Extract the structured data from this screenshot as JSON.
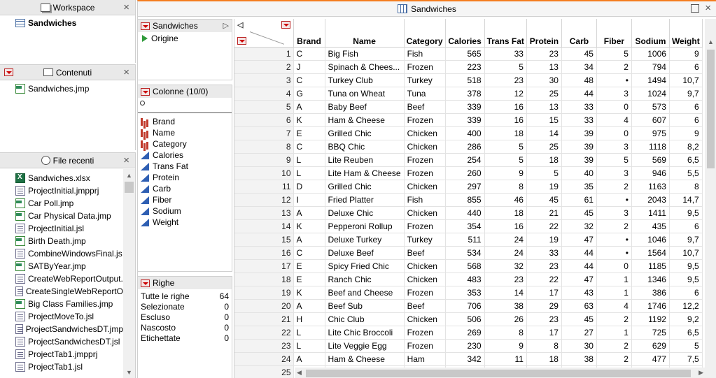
{
  "workspace": {
    "title": "Workspace",
    "item": "Sandwiches"
  },
  "contents": {
    "title": "Contenuti",
    "item": "Sandwiches.jmp"
  },
  "recent": {
    "title": "File recenti",
    "items": [
      {
        "label": "Sandwiches.xlsx",
        "icon": "xlsx-icon"
      },
      {
        "label": "ProjectInitial.jmpprj",
        "icon": "file-icon"
      },
      {
        "label": "Car Poll.jmp",
        "icon": "jmp-table-icon"
      },
      {
        "label": "Car Physical Data.jmp",
        "icon": "jmp-table-icon"
      },
      {
        "label": "ProjectInitial.jsl",
        "icon": "file-icon"
      },
      {
        "label": "Birth Death.jmp",
        "icon": "jmp-table-icon"
      },
      {
        "label": "CombineWindowsFinal.js",
        "icon": "file-icon"
      },
      {
        "label": "SATByYear.jmp",
        "icon": "jmp-table-icon"
      },
      {
        "label": "CreateWebReportOutput.",
        "icon": "file-icon"
      },
      {
        "label": "CreateSingleWebReportO",
        "icon": "file-icon"
      },
      {
        "label": "Big Class Families.jmp",
        "icon": "jmp-table-icon"
      },
      {
        "label": "ProjectMoveTo.jsl",
        "icon": "file-icon"
      },
      {
        "label": "ProjectSandwichesDT.jmp",
        "icon": "file-icon"
      },
      {
        "label": "ProjectSandwichesDT.jsl",
        "icon": "file-icon"
      },
      {
        "label": "ProjectTab1.jmpprj",
        "icon": "file-icon"
      },
      {
        "label": "ProjectTab1.jsl",
        "icon": "file-icon"
      }
    ]
  },
  "window": {
    "title": "Sandwiches"
  },
  "table_panel": {
    "name": "Sandwiches",
    "source": "Origine"
  },
  "columns_panel": {
    "title": "Colonne (10/0)",
    "columns": [
      {
        "label": "Brand",
        "icon": "nominal-column-icon"
      },
      {
        "label": "Name",
        "icon": "nominal-column-icon"
      },
      {
        "label": "Category",
        "icon": "nominal-column-icon"
      },
      {
        "label": "Calories",
        "icon": "continuous-column-icon"
      },
      {
        "label": "Trans Fat",
        "icon": "continuous-column-icon"
      },
      {
        "label": "Protein",
        "icon": "continuous-column-icon"
      },
      {
        "label": "Carb",
        "icon": "continuous-column-icon"
      },
      {
        "label": "Fiber",
        "icon": "continuous-column-icon"
      },
      {
        "label": "Sodium",
        "icon": "continuous-column-icon"
      },
      {
        "label": "Weight",
        "icon": "continuous-column-icon"
      }
    ]
  },
  "rows_panel": {
    "title": "Righe",
    "items": [
      {
        "label": "Tutte le righe",
        "value": "64"
      },
      {
        "label": "Selezionate",
        "value": "0"
      },
      {
        "label": "Escluso",
        "value": "0"
      },
      {
        "label": "Nascosto",
        "value": "0"
      },
      {
        "label": "Etichettate",
        "value": "0"
      }
    ]
  },
  "grid": {
    "headers": [
      "Brand",
      "Name",
      "Category",
      "Calories",
      "Trans Fat",
      "Protein",
      "Carb",
      "Fiber",
      "Sodium",
      "Weight"
    ],
    "rows": [
      [
        "1",
        "C",
        "Big Fish",
        "Fish",
        "565",
        "33",
        "23",
        "45",
        "5",
        "1006",
        "9"
      ],
      [
        "2",
        "J",
        "Spinach & Chees...",
        "Frozen",
        "223",
        "5",
        "13",
        "34",
        "2",
        "794",
        "6"
      ],
      [
        "3",
        "C",
        "Turkey Club",
        "Turkey",
        "518",
        "23",
        "30",
        "48",
        "•",
        "1494",
        "10,7"
      ],
      [
        "4",
        "G",
        "Tuna on Wheat",
        "Tuna",
        "378",
        "12",
        "25",
        "44",
        "3",
        "1024",
        "9,7"
      ],
      [
        "5",
        "A",
        "Baby Beef",
        "Beef",
        "339",
        "16",
        "13",
        "33",
        "0",
        "573",
        "6"
      ],
      [
        "6",
        "K",
        "Ham & Cheese",
        "Frozen",
        "339",
        "16",
        "15",
        "33",
        "4",
        "607",
        "6"
      ],
      [
        "7",
        "E",
        "Grilled Chic",
        "Chicken",
        "400",
        "18",
        "14",
        "39",
        "0",
        "975",
        "9"
      ],
      [
        "8",
        "C",
        "BBQ Chic",
        "Chicken",
        "286",
        "5",
        "25",
        "39",
        "3",
        "1118",
        "8,2"
      ],
      [
        "9",
        "L",
        "Lite Reuben",
        "Frozen",
        "254",
        "5",
        "18",
        "39",
        "5",
        "569",
        "6,5"
      ],
      [
        "10",
        "L",
        "Lite Ham & Cheese",
        "Frozen",
        "260",
        "9",
        "5",
        "40",
        "3",
        "946",
        "5,5"
      ],
      [
        "11",
        "D",
        "Grilled Chic",
        "Chicken",
        "297",
        "8",
        "19",
        "35",
        "2",
        "1163",
        "8"
      ],
      [
        "12",
        "I",
        "Fried Platter",
        "Fish",
        "855",
        "46",
        "45",
        "61",
        "•",
        "2043",
        "14,7"
      ],
      [
        "13",
        "A",
        "Deluxe Chic",
        "Chicken",
        "440",
        "18",
        "21",
        "45",
        "3",
        "1411",
        "9,5"
      ],
      [
        "14",
        "K",
        "Pepperoni Rollup",
        "Frozen",
        "354",
        "16",
        "22",
        "32",
        "2",
        "435",
        "6"
      ],
      [
        "15",
        "A",
        "Deluxe Turkey",
        "Turkey",
        "511",
        "24",
        "19",
        "47",
        "•",
        "1046",
        "9,7"
      ],
      [
        "16",
        "C",
        "Deluxe Beef",
        "Beef",
        "534",
        "24",
        "33",
        "44",
        "•",
        "1564",
        "10,7"
      ],
      [
        "17",
        "E",
        "Spicy Fried Chic",
        "Chicken",
        "568",
        "32",
        "23",
        "44",
        "0",
        "1185",
        "9,5"
      ],
      [
        "18",
        "E",
        "Ranch Chic",
        "Chicken",
        "483",
        "23",
        "22",
        "47",
        "1",
        "1346",
        "9,5"
      ],
      [
        "19",
        "K",
        "Beef and Cheese",
        "Frozen",
        "353",
        "14",
        "17",
        "43",
        "1",
        "386",
        "6"
      ],
      [
        "20",
        "A",
        "Beef Sub",
        "Beef",
        "706",
        "38",
        "29",
        "63",
        "4",
        "1746",
        "12,2"
      ],
      [
        "21",
        "H",
        "Chic Club",
        "Chicken",
        "506",
        "26",
        "23",
        "45",
        "2",
        "1192",
        "9,2"
      ],
      [
        "22",
        "L",
        "Lite Chic Broccoli",
        "Frozen",
        "269",
        "8",
        "17",
        "27",
        "1",
        "725",
        "6,5"
      ],
      [
        "23",
        "L",
        "Lite Veggie Egg",
        "Frozen",
        "230",
        "9",
        "8",
        "30",
        "2",
        "629",
        "5"
      ],
      [
        "24",
        "A",
        "Ham & Cheese",
        "Ham",
        "342",
        "11",
        "18",
        "38",
        "2",
        "477",
        "7,5"
      ],
      [
        "25",
        "",
        "",
        "",
        "",
        "",
        "",
        "",
        "",
        "",
        ""
      ]
    ]
  },
  "colors": {
    "accent_orange": "#f47d20",
    "header_bg": "#e9e9e9",
    "row_header_bg": "#f3f3f3",
    "nominal_red": "#c0392b",
    "continuous_blue": "#2f5fb3"
  }
}
